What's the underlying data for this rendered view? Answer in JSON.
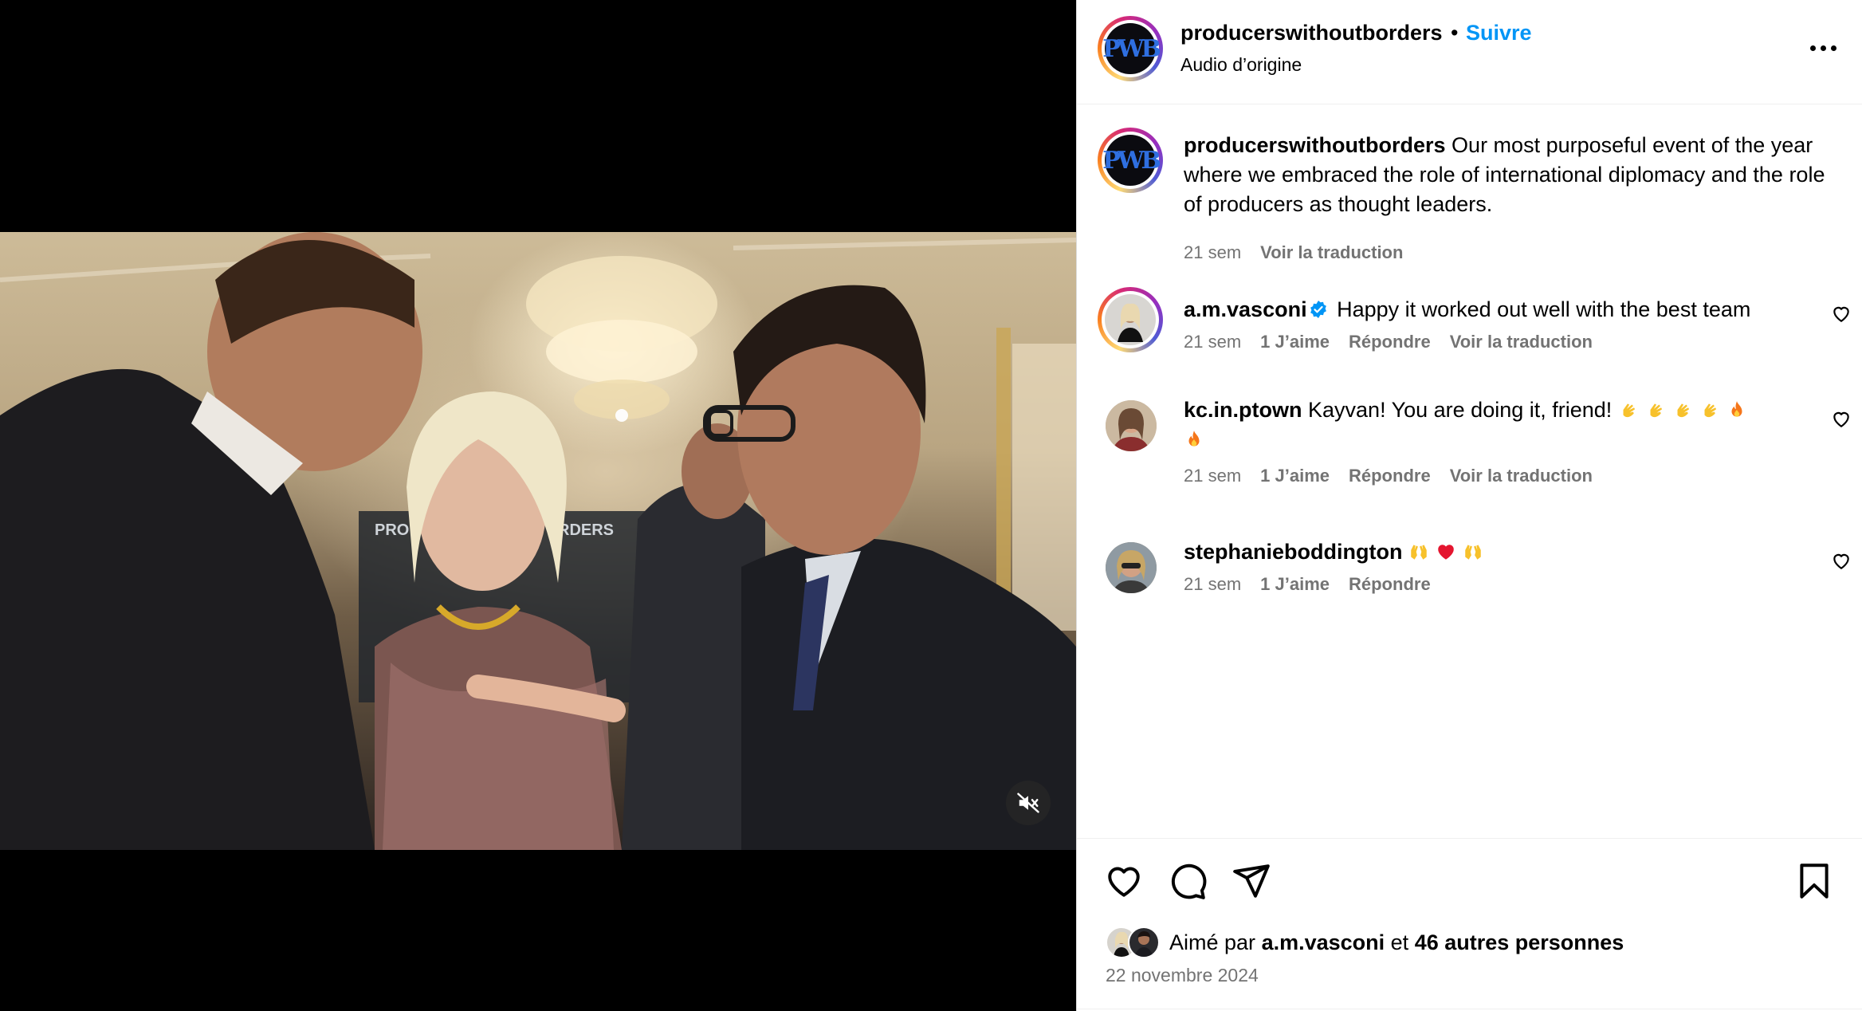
{
  "post": {
    "author": "producerswithoutborders",
    "separator": "•",
    "follow_label": "Suivre",
    "audio": "Audio d’origine",
    "avatar_text": "PWB"
  },
  "caption": {
    "username": "producerswithoutborders",
    "text": "Our most purposeful event of the year where we embraced the role of international diplomacy and the role of producers as thought leaders.",
    "time": "21 sem",
    "translate": "Voir la traduction"
  },
  "comments": [
    {
      "username": "a.m.vasconi",
      "verified": true,
      "text": "Happy it worked out well with the best team",
      "time": "21 sem",
      "likes": "1 J’aime",
      "reply": "Répondre",
      "translate": "Voir la traduction"
    },
    {
      "username": "kc.in.ptown",
      "text": "Kayvan! You are doing it, friend!",
      "emojis": [
        "clapping-hands",
        "clapping-hands",
        "clapping-hands",
        "clapping-hands",
        "fire",
        "fire"
      ],
      "time": "21 sem",
      "likes": "1 J’aime",
      "reply": "Répondre",
      "translate": "Voir la traduction"
    },
    {
      "username": "stephanieboddington",
      "emojis": [
        "raising-hands",
        "red-heart",
        "raising-hands"
      ],
      "time": "21 sem",
      "likes": "1 J’aime",
      "reply": "Répondre"
    }
  ],
  "likes": {
    "prefix": "Aimé par",
    "user": "a.m.vasconi",
    "joiner": "et",
    "others": "46 autres personnes"
  },
  "date": "22 novembre 2024",
  "icons": {
    "like": "heart-icon",
    "comment": "comment-icon",
    "share": "paper-plane-icon",
    "save": "bookmark-icon",
    "mute": "speaker-muted-icon",
    "more": "more-options-icon",
    "verified": "verified-badge-icon"
  },
  "colors": {
    "accent": "#0095f6",
    "secondary_text": "#737373",
    "heart_red": "#ed4956"
  }
}
